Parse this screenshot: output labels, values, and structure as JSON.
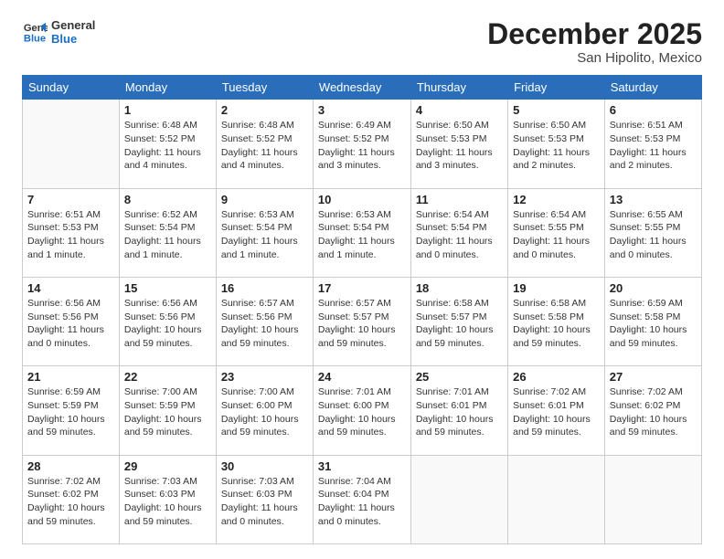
{
  "logo": {
    "line1": "General",
    "line2": "Blue"
  },
  "title": "December 2025",
  "subtitle": "San Hipolito, Mexico",
  "days_header": [
    "Sunday",
    "Monday",
    "Tuesday",
    "Wednesday",
    "Thursday",
    "Friday",
    "Saturday"
  ],
  "weeks": [
    [
      {
        "num": "",
        "info": ""
      },
      {
        "num": "1",
        "info": "Sunrise: 6:48 AM\nSunset: 5:52 PM\nDaylight: 11 hours\nand 4 minutes."
      },
      {
        "num": "2",
        "info": "Sunrise: 6:48 AM\nSunset: 5:52 PM\nDaylight: 11 hours\nand 4 minutes."
      },
      {
        "num": "3",
        "info": "Sunrise: 6:49 AM\nSunset: 5:52 PM\nDaylight: 11 hours\nand 3 minutes."
      },
      {
        "num": "4",
        "info": "Sunrise: 6:50 AM\nSunset: 5:53 PM\nDaylight: 11 hours\nand 3 minutes."
      },
      {
        "num": "5",
        "info": "Sunrise: 6:50 AM\nSunset: 5:53 PM\nDaylight: 11 hours\nand 2 minutes."
      },
      {
        "num": "6",
        "info": "Sunrise: 6:51 AM\nSunset: 5:53 PM\nDaylight: 11 hours\nand 2 minutes."
      }
    ],
    [
      {
        "num": "7",
        "info": "Sunrise: 6:51 AM\nSunset: 5:53 PM\nDaylight: 11 hours\nand 1 minute."
      },
      {
        "num": "8",
        "info": "Sunrise: 6:52 AM\nSunset: 5:54 PM\nDaylight: 11 hours\nand 1 minute."
      },
      {
        "num": "9",
        "info": "Sunrise: 6:53 AM\nSunset: 5:54 PM\nDaylight: 11 hours\nand 1 minute."
      },
      {
        "num": "10",
        "info": "Sunrise: 6:53 AM\nSunset: 5:54 PM\nDaylight: 11 hours\nand 1 minute."
      },
      {
        "num": "11",
        "info": "Sunrise: 6:54 AM\nSunset: 5:54 PM\nDaylight: 11 hours\nand 0 minutes."
      },
      {
        "num": "12",
        "info": "Sunrise: 6:54 AM\nSunset: 5:55 PM\nDaylight: 11 hours\nand 0 minutes."
      },
      {
        "num": "13",
        "info": "Sunrise: 6:55 AM\nSunset: 5:55 PM\nDaylight: 11 hours\nand 0 minutes."
      }
    ],
    [
      {
        "num": "14",
        "info": "Sunrise: 6:56 AM\nSunset: 5:56 PM\nDaylight: 11 hours\nand 0 minutes."
      },
      {
        "num": "15",
        "info": "Sunrise: 6:56 AM\nSunset: 5:56 PM\nDaylight: 10 hours\nand 59 minutes."
      },
      {
        "num": "16",
        "info": "Sunrise: 6:57 AM\nSunset: 5:56 PM\nDaylight: 10 hours\nand 59 minutes."
      },
      {
        "num": "17",
        "info": "Sunrise: 6:57 AM\nSunset: 5:57 PM\nDaylight: 10 hours\nand 59 minutes."
      },
      {
        "num": "18",
        "info": "Sunrise: 6:58 AM\nSunset: 5:57 PM\nDaylight: 10 hours\nand 59 minutes."
      },
      {
        "num": "19",
        "info": "Sunrise: 6:58 AM\nSunset: 5:58 PM\nDaylight: 10 hours\nand 59 minutes."
      },
      {
        "num": "20",
        "info": "Sunrise: 6:59 AM\nSunset: 5:58 PM\nDaylight: 10 hours\nand 59 minutes."
      }
    ],
    [
      {
        "num": "21",
        "info": "Sunrise: 6:59 AM\nSunset: 5:59 PM\nDaylight: 10 hours\nand 59 minutes."
      },
      {
        "num": "22",
        "info": "Sunrise: 7:00 AM\nSunset: 5:59 PM\nDaylight: 10 hours\nand 59 minutes."
      },
      {
        "num": "23",
        "info": "Sunrise: 7:00 AM\nSunset: 6:00 PM\nDaylight: 10 hours\nand 59 minutes."
      },
      {
        "num": "24",
        "info": "Sunrise: 7:01 AM\nSunset: 6:00 PM\nDaylight: 10 hours\nand 59 minutes."
      },
      {
        "num": "25",
        "info": "Sunrise: 7:01 AM\nSunset: 6:01 PM\nDaylight: 10 hours\nand 59 minutes."
      },
      {
        "num": "26",
        "info": "Sunrise: 7:02 AM\nSunset: 6:01 PM\nDaylight: 10 hours\nand 59 minutes."
      },
      {
        "num": "27",
        "info": "Sunrise: 7:02 AM\nSunset: 6:02 PM\nDaylight: 10 hours\nand 59 minutes."
      }
    ],
    [
      {
        "num": "28",
        "info": "Sunrise: 7:02 AM\nSunset: 6:02 PM\nDaylight: 10 hours\nand 59 minutes."
      },
      {
        "num": "29",
        "info": "Sunrise: 7:03 AM\nSunset: 6:03 PM\nDaylight: 10 hours\nand 59 minutes."
      },
      {
        "num": "30",
        "info": "Sunrise: 7:03 AM\nSunset: 6:03 PM\nDaylight: 11 hours\nand 0 minutes."
      },
      {
        "num": "31",
        "info": "Sunrise: 7:04 AM\nSunset: 6:04 PM\nDaylight: 11 hours\nand 0 minutes."
      },
      {
        "num": "",
        "info": ""
      },
      {
        "num": "",
        "info": ""
      },
      {
        "num": "",
        "info": ""
      }
    ]
  ]
}
